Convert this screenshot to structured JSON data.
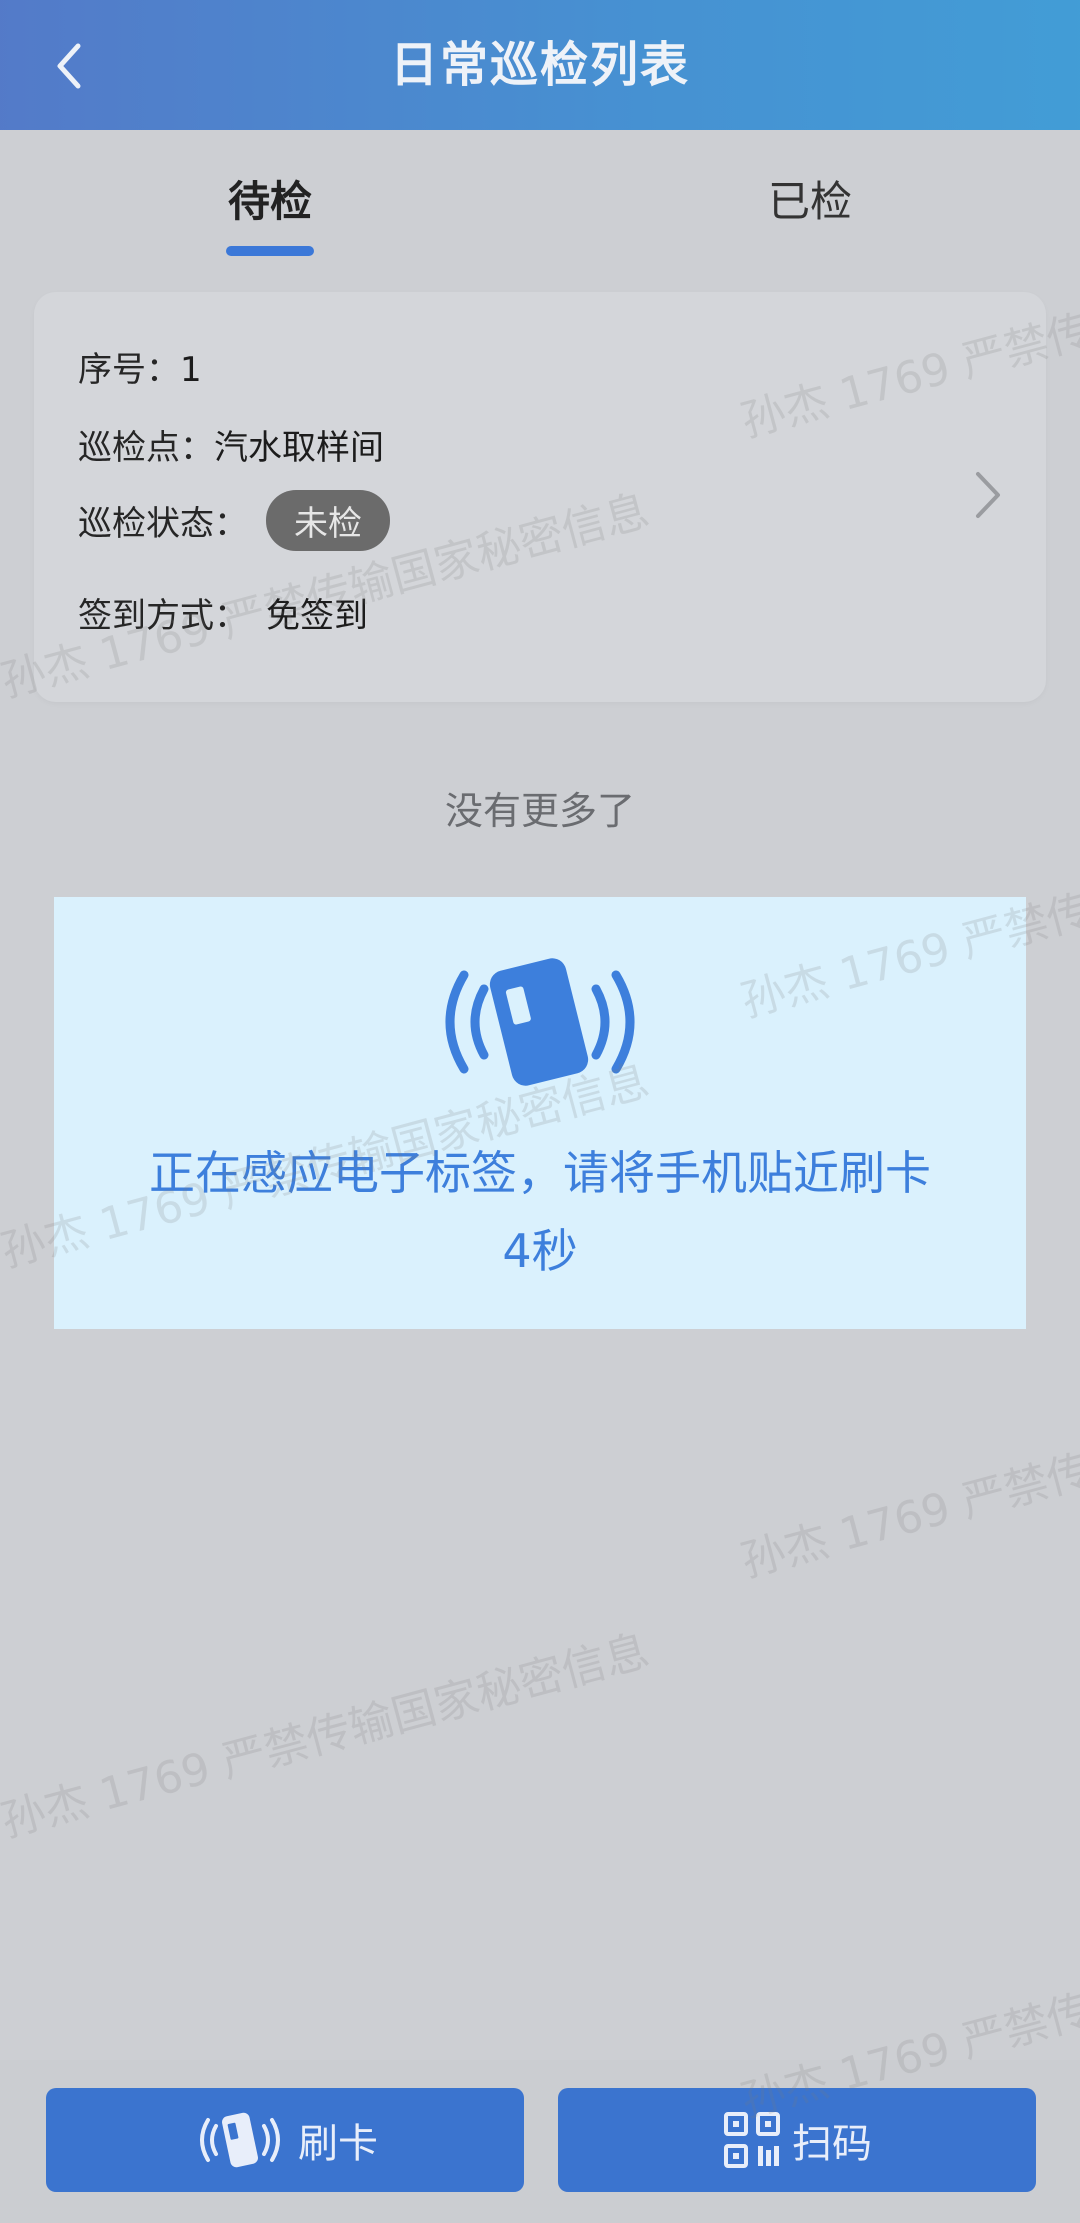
{
  "header": {
    "title": "日常巡检列表",
    "back_icon": "chevron-left-icon"
  },
  "tabs": [
    {
      "label": "待检",
      "active": true
    },
    {
      "label": "已检",
      "active": false
    }
  ],
  "card": {
    "seq_label": "序号：",
    "seq_value": "1",
    "point_label": "巡检点：",
    "point_value": "汽水取样间",
    "status_label": "巡检状态：",
    "status_value": "未检",
    "signin_label": "签到方式：",
    "signin_value": "免签到"
  },
  "list_footer": "没有更多了",
  "nfc": {
    "message": "正在感应电子标签，请将手机贴近刷卡",
    "countdown": "4秒",
    "icon": "nfc-card-icon"
  },
  "bottom": {
    "card_button_label": "刷卡",
    "scan_button_label": "扫码"
  },
  "watermark": {
    "line1": "孙杰 1769 严禁传输国家秘密信息"
  },
  "colors": {
    "accent": "#3b78d8",
    "header_start": "#4d76c8",
    "header_end": "#3b9ad6",
    "nfc_bg": "#daf1fd",
    "nfc_text": "#3d7fdc"
  }
}
